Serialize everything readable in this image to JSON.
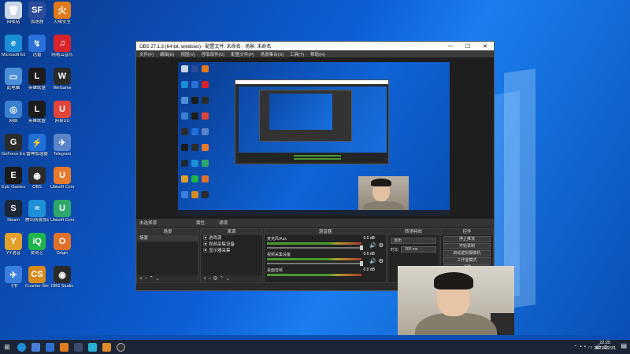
{
  "desktop_icons": [
    {
      "label": "回收站",
      "color": "#c9d6e8",
      "glyph": "🗑"
    },
    {
      "label": "加速器",
      "color": "#2b4a9a",
      "glyph": "SF"
    },
    {
      "label": "火绒安全",
      "color": "#e07a1a",
      "glyph": "火"
    },
    {
      "label": "Microsoft Edge",
      "color": "#1a8fd8",
      "glyph": "e"
    },
    {
      "label": "迅雷",
      "color": "#2b6fd8",
      "glyph": "↯"
    },
    {
      "label": "网易云音乐",
      "color": "#d8232a",
      "glyph": "♫"
    },
    {
      "label": "此电脑",
      "color": "#4a90d8",
      "glyph": "▭"
    },
    {
      "label": "英雄联盟",
      "color": "#1c1c1c",
      "glyph": "L"
    },
    {
      "label": "WeGame",
      "color": "#2a2a2a",
      "glyph": "W"
    },
    {
      "label": "网络",
      "color": "#3a80d0",
      "glyph": "◎"
    },
    {
      "label": "英雄联盟",
      "color": "#1c1c1c",
      "glyph": "L"
    },
    {
      "label": "网易UU",
      "color": "#e0453a",
      "glyph": "U"
    },
    {
      "label": "GeForce Experience",
      "color": "#2c2c2c",
      "glyph": "G"
    },
    {
      "label": "雷神加速器",
      "color": "#1e6fd8",
      "glyph": "⚡"
    },
    {
      "label": "Telegram",
      "color": "#5a84c8",
      "glyph": "✈"
    },
    {
      "label": "Epic Games Launcher",
      "color": "#1a1a1a",
      "glyph": "E"
    },
    {
      "label": "OBS",
      "color": "#2a2a2a",
      "glyph": "◉"
    },
    {
      "label": "Ubisoft Connect",
      "color": "#e57a2a",
      "glyph": "U"
    },
    {
      "label": "Steam",
      "color": "#1b2838",
      "glyph": "S"
    },
    {
      "label": "腾讯网游加速器",
      "color": "#1e90d8",
      "glyph": "≈"
    },
    {
      "label": "Ubisoft Connect",
      "color": "#2ea86a",
      "glyph": "U"
    },
    {
      "label": "YY语音",
      "color": "#e0a02a",
      "glyph": "Y"
    },
    {
      "label": "爱奇艺",
      "color": "#1fb54a",
      "glyph": "iQ"
    },
    {
      "label": "Origin",
      "color": "#e0702a",
      "glyph": "O"
    },
    {
      "label": "飞书",
      "color": "#3a7fe0",
      "glyph": "✈"
    },
    {
      "label": "Counter-Strike",
      "color": "#d88a1a",
      "glyph": "CS"
    },
    {
      "label": "OBS Studio",
      "color": "#2a2a2a",
      "glyph": "◉"
    }
  ],
  "obs": {
    "title": "OBS 27.1.3 (64-bit, windows) - 配置文件: 未命名 - 场景: 未命名",
    "menu": [
      "文件(F)",
      "编辑(E)",
      "视图(V)",
      "停靠部件(D)",
      "配置文件(P)",
      "场景集合(S)",
      "工具(T)",
      "帮助(H)"
    ],
    "ctrl_bar": "未选择源",
    "ctrl_props": "属性",
    "ctrl_filters": "滤镜",
    "panels": {
      "scenes": {
        "title": "场景",
        "items": [
          "场景"
        ]
      },
      "sources": {
        "title": "来源",
        "items": [
          "游戏源",
          "视频采集设备",
          "显示器采集"
        ]
      },
      "mixer": {
        "title": "混音器",
        "channels": [
          {
            "name": "麦克风/Aux",
            "db": "0.0 dB"
          },
          {
            "name": "视频采集设备",
            "db": "0.0 dB"
          },
          {
            "name": "桌面音频",
            "db": "0.0 dB"
          }
        ]
      },
      "transitions": {
        "title": "转场特效",
        "type": "淡出",
        "duration_label": "时长",
        "duration": "300 ms"
      },
      "controls": {
        "title": "控件",
        "buttons": [
          "停止推流",
          "开始录制",
          "启动虚拟摄像机",
          "工作室模式",
          "设置",
          "退出"
        ]
      }
    },
    "status": "LIVE: 00:00:00  REC: 00:00:00  CPU: 0.0%, 60.00 fps"
  },
  "taskbar": {
    "time": "22:25",
    "date": "2021/12/31",
    "lang": "中"
  }
}
